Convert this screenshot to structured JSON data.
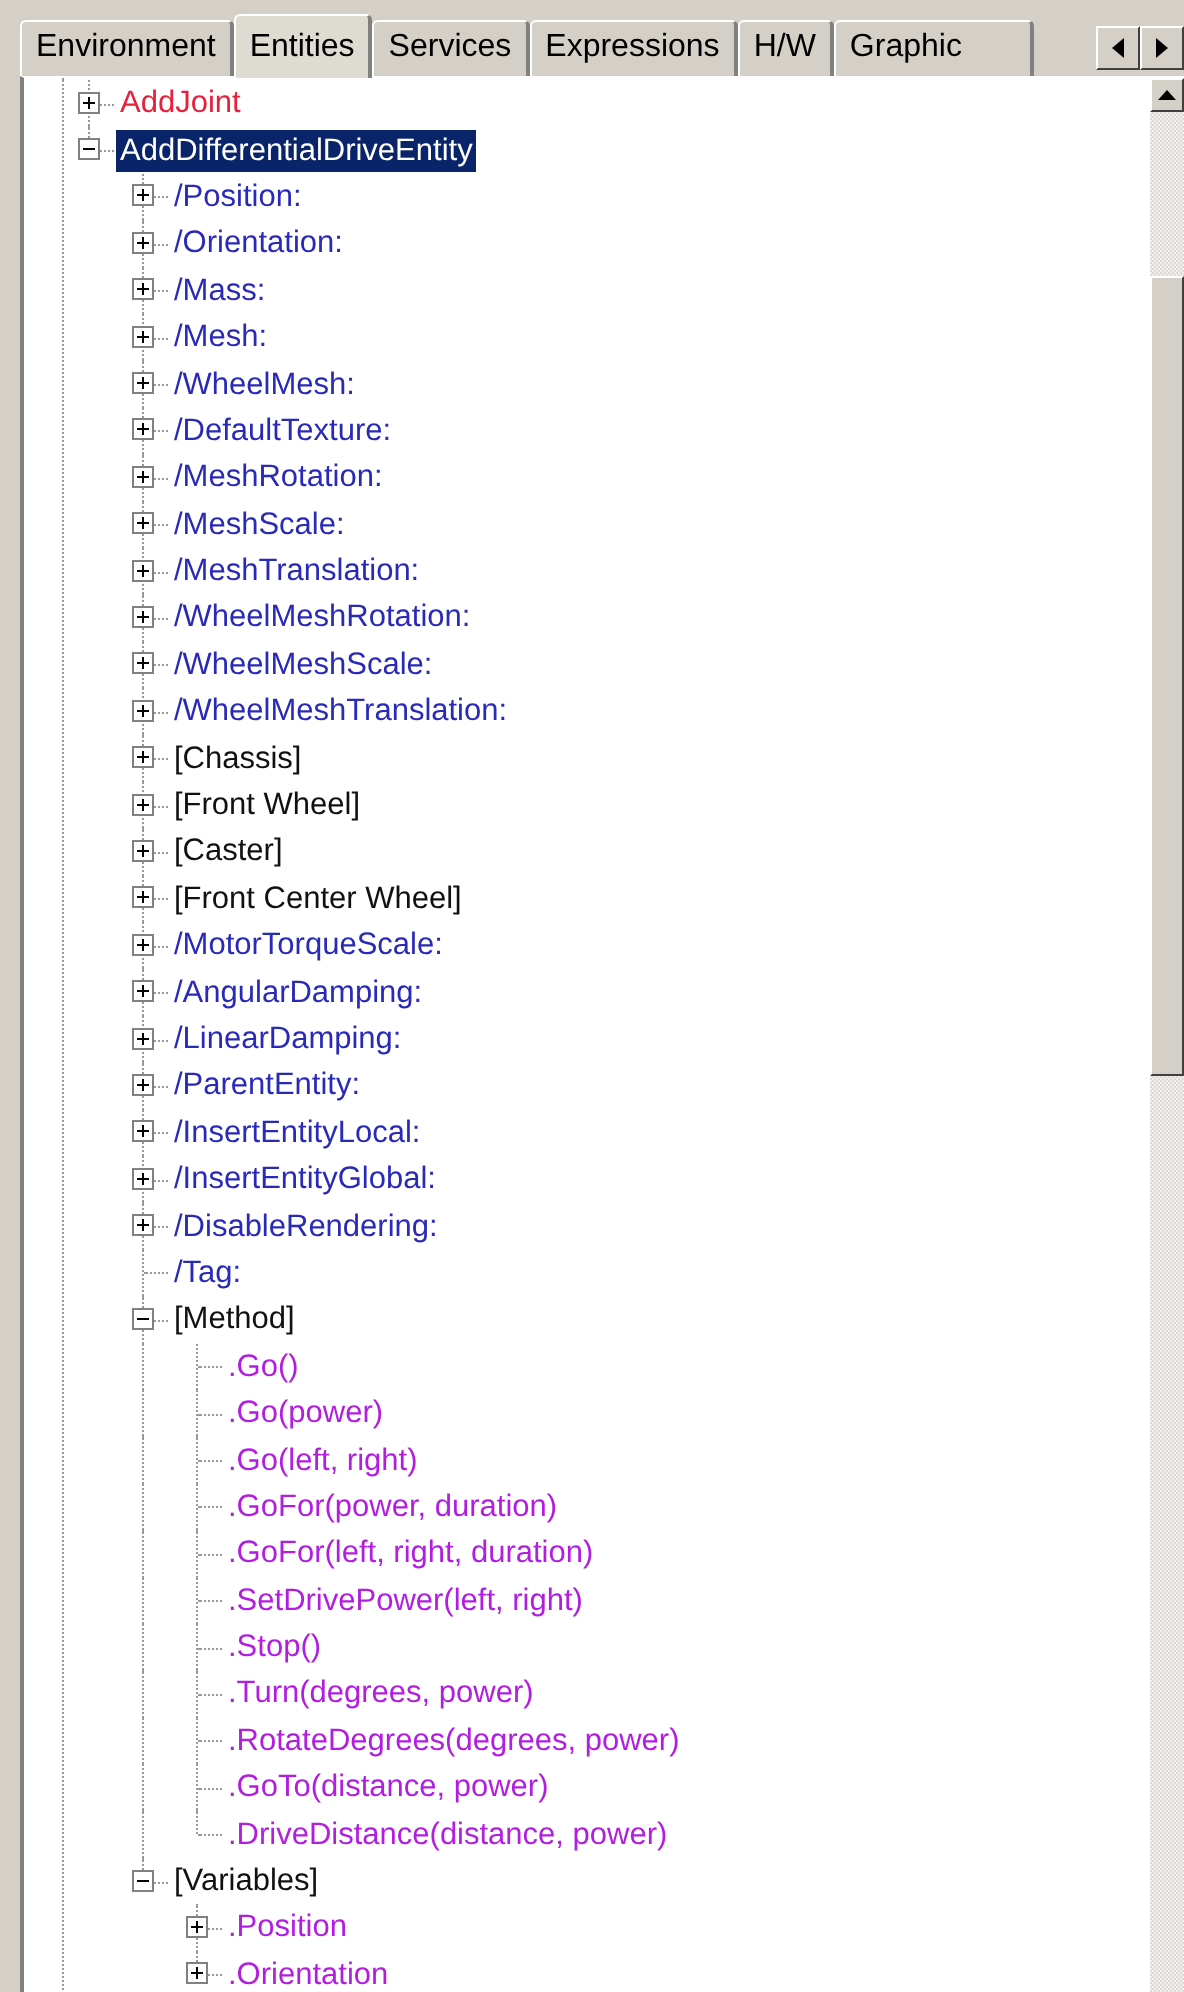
{
  "tabs": [
    {
      "label": "Environment",
      "selected": false
    },
    {
      "label": "Entities",
      "selected": true
    },
    {
      "label": "Services",
      "selected": false
    },
    {
      "label": "Expressions",
      "selected": false
    },
    {
      "label": "H/W",
      "selected": false
    },
    {
      "label": "Graphic",
      "selected": false
    }
  ],
  "tree": [
    {
      "label": "AddJoint",
      "kind": "command",
      "selected": false,
      "expanded": false
    },
    {
      "label": "AddDifferentialDriveEntity",
      "kind": "command",
      "selected": true,
      "expanded": true,
      "children": [
        {
          "label": "/Position:",
          "kind": "property",
          "selected": false,
          "expanded": false
        },
        {
          "label": "/Orientation:",
          "kind": "property",
          "selected": false,
          "expanded": false
        },
        {
          "label": "/Mass:",
          "kind": "property",
          "selected": false,
          "expanded": false
        },
        {
          "label": "/Mesh:",
          "kind": "property",
          "selected": false,
          "expanded": false
        },
        {
          "label": "/WheelMesh:",
          "kind": "property",
          "selected": false,
          "expanded": false
        },
        {
          "label": "/DefaultTexture:",
          "kind": "property",
          "selected": false,
          "expanded": false
        },
        {
          "label": "/MeshRotation:",
          "kind": "property",
          "selected": false,
          "expanded": false
        },
        {
          "label": "/MeshScale:",
          "kind": "property",
          "selected": false,
          "expanded": false
        },
        {
          "label": "/MeshTranslation:",
          "kind": "property",
          "selected": false,
          "expanded": false
        },
        {
          "label": "/WheelMeshRotation:",
          "kind": "property",
          "selected": false,
          "expanded": false
        },
        {
          "label": "/WheelMeshScale:",
          "kind": "property",
          "selected": false,
          "expanded": false
        },
        {
          "label": "/WheelMeshTranslation:",
          "kind": "property",
          "selected": false,
          "expanded": false
        },
        {
          "label": "[Chassis]",
          "kind": "group",
          "selected": false,
          "expanded": false
        },
        {
          "label": "[Front Wheel]",
          "kind": "group",
          "selected": false,
          "expanded": false
        },
        {
          "label": "[Caster]",
          "kind": "group",
          "selected": false,
          "expanded": false
        },
        {
          "label": "[Front Center Wheel]",
          "kind": "group",
          "selected": false,
          "expanded": false
        },
        {
          "label": "/MotorTorqueScale:",
          "kind": "property",
          "selected": false,
          "expanded": false
        },
        {
          "label": "/AngularDamping:",
          "kind": "property",
          "selected": false,
          "expanded": false
        },
        {
          "label": "/LinearDamping:",
          "kind": "property",
          "selected": false,
          "expanded": false
        },
        {
          "label": "/ParentEntity:",
          "kind": "property",
          "selected": false,
          "expanded": false
        },
        {
          "label": "/InsertEntityLocal:",
          "kind": "property",
          "selected": false,
          "expanded": false
        },
        {
          "label": "/InsertEntityGlobal:",
          "kind": "property",
          "selected": false,
          "expanded": false
        },
        {
          "label": "/DisableRendering:",
          "kind": "property",
          "selected": false,
          "expanded": false
        },
        {
          "label": "/Tag:",
          "kind": "property",
          "selected": false
        },
        {
          "label": "[Method]",
          "kind": "group",
          "selected": false,
          "expanded": true,
          "children": [
            {
              "label": ".Go()",
              "kind": "method",
              "selected": false
            },
            {
              "label": ".Go(power)",
              "kind": "method",
              "selected": false
            },
            {
              "label": ".Go(left, right)",
              "kind": "method",
              "selected": false
            },
            {
              "label": ".GoFor(power, duration)",
              "kind": "method",
              "selected": false
            },
            {
              "label": ".GoFor(left, right, duration)",
              "kind": "method",
              "selected": false
            },
            {
              "label": ".SetDrivePower(left, right)",
              "kind": "method",
              "selected": false
            },
            {
              "label": ".Stop()",
              "kind": "method",
              "selected": false
            },
            {
              "label": ".Turn(degrees, power)",
              "kind": "method",
              "selected": false
            },
            {
              "label": ".RotateDegrees(degrees, power)",
              "kind": "method",
              "selected": false
            },
            {
              "label": ".GoTo(distance, power)",
              "kind": "method",
              "selected": false
            },
            {
              "label": ".DriveDistance(distance, power)",
              "kind": "method",
              "selected": false
            }
          ]
        },
        {
          "label": "[Variables]",
          "kind": "group",
          "selected": false,
          "expanded": true,
          "children": [
            {
              "label": ".Position",
              "kind": "method",
              "selected": false,
              "expanded": false
            },
            {
              "label": ".Orientation",
              "kind": "method",
              "selected": false,
              "expanded": false
            }
          ]
        }
      ]
    }
  ]
}
